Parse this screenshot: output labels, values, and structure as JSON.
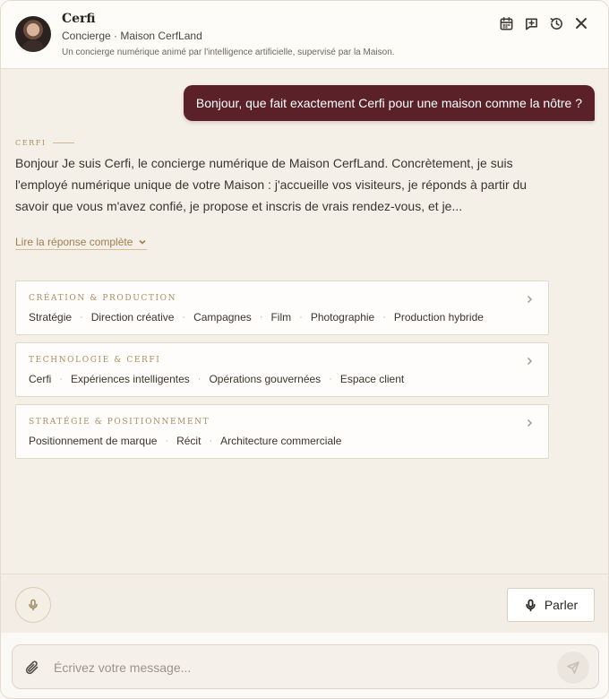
{
  "header": {
    "title": "Cerfi",
    "subtitle": "Concierge · Maison CerfLand",
    "disclaimer": "Un concierge numérique animé par l'intelligence artificielle, supervisé par la Maison.",
    "icons": [
      "calendar-icon",
      "new-chat-icon",
      "history-icon",
      "close-icon"
    ]
  },
  "conversation": {
    "user_message": "Bonjour, que fait exactement Cerfi pour une maison comme la nôtre ?",
    "assistant_label": "CERFI",
    "assistant_message": "Bonjour Je suis Cerfi, le concierge numérique de Maison CerfLand. Concrètement, je suis l'employé numérique unique de votre Maison : j'accueille vos visiteurs, je réponds à partir du savoir que vous m'avez confié, je propose et inscris de vrais rendez-vous, et je...",
    "read_more": "Lire la réponse complète"
  },
  "cards": [
    {
      "title": "CRÉATION & PRODUCTION",
      "tags": [
        "Stratégie",
        "Direction créative",
        "Campagnes",
        "Film",
        "Photographie",
        "Production hybride"
      ]
    },
    {
      "title": "TECHNOLOGIE & CERFI",
      "tags": [
        "Cerfi",
        "Expériences intelligentes",
        "Opérations gouvernées",
        "Espace client"
      ]
    },
    {
      "title": "STRATÉGIE & POSITIONNEMENT",
      "tags": [
        "Positionnement de marque",
        "Récit",
        "Architecture commerciale"
      ]
    }
  ],
  "voice": {
    "speak_label": "Parler"
  },
  "composer": {
    "placeholder": "Écrivez votre message..."
  },
  "colors": {
    "accent": "#5a2128",
    "gold": "#a98e62",
    "background": "#f4f0e8"
  }
}
